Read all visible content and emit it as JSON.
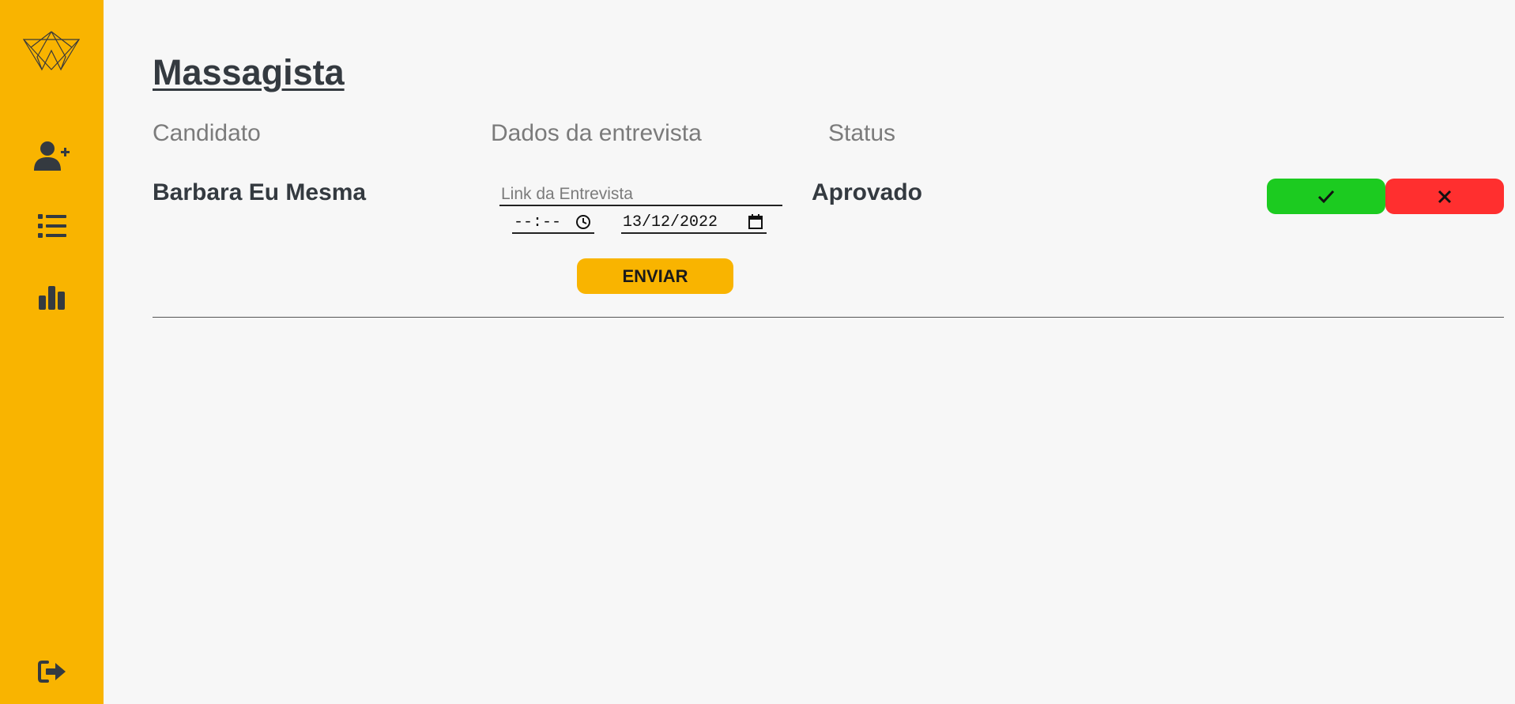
{
  "sidebar": {
    "items": [
      {
        "icon": "user-plus-icon"
      },
      {
        "icon": "list-icon"
      },
      {
        "icon": "bar-chart-icon"
      }
    ],
    "logout_icon": "logout-icon",
    "accent_color": "#f9b400"
  },
  "page": {
    "title": "Massagista"
  },
  "table": {
    "headers": [
      "Candidato",
      "Dados da entrevista",
      "Status"
    ],
    "rows": [
      {
        "candidate": "Barbara Eu Mesma",
        "interview_link_placeholder": "Link da Entrevista",
        "interview_link_value": "",
        "time_value": "--:--",
        "date_value": "13/12/2022",
        "send_label": "ENVIAR",
        "status": "Aprovado",
        "approve_icon": "check-icon",
        "reject_icon": "close-icon"
      }
    ]
  },
  "colors": {
    "approve": "#1ccb20",
    "reject": "#ff2f2f",
    "text_dark": "#343a40",
    "text_muted": "#7b7b7b"
  }
}
